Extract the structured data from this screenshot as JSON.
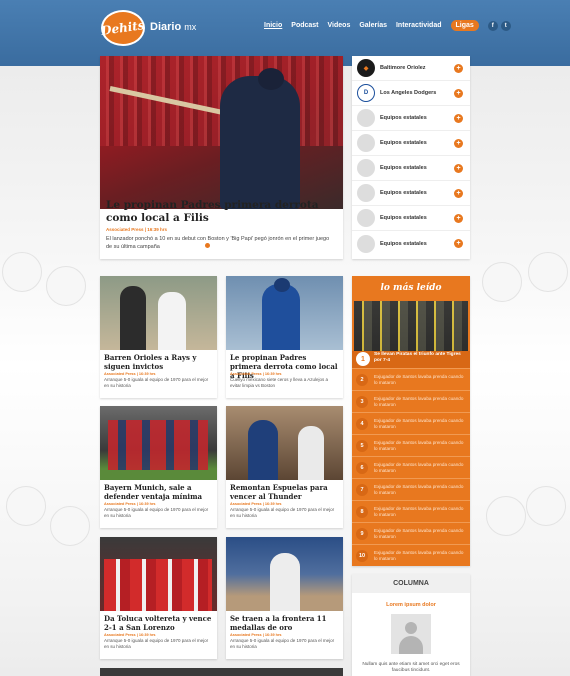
{
  "header": {
    "logo_text": "Dehits",
    "partner_name": "Diario",
    "partner_suffix": "mx",
    "nav": [
      {
        "label": "Inicio",
        "active": true
      },
      {
        "label": "Podcast"
      },
      {
        "label": "Videos"
      },
      {
        "label": "Galerías"
      },
      {
        "label": "Interactividad"
      },
      {
        "label": "Ligas",
        "pill": true
      }
    ],
    "social": [
      {
        "icon": "facebook-icon",
        "glyph": "f"
      },
      {
        "icon": "twitter-icon",
        "glyph": "t"
      }
    ],
    "colors": {
      "header_blue": "#3f74a8",
      "accent_orange": "#e8781f"
    }
  },
  "featured": {
    "title": "Le propinan Padres primera derrota como local a Filis",
    "byline_author": "Associated Press",
    "byline_time": "16:39 hrs",
    "summary": "El lanzador ponchó a 10 en su debut con Boston y 'Big Papi' pegó jonrón en el primer juego de su última campaña",
    "slides": 4,
    "active_slide": 1
  },
  "teams": [
    {
      "name": "Baltimore Oriolez",
      "logo": "orioles-logo"
    },
    {
      "name": "Los Angeles Dodgers",
      "logo": "dodgers-logo"
    },
    {
      "name": "Equipos estatales"
    },
    {
      "name": "Equipos estatales"
    },
    {
      "name": "Equipos estatales"
    },
    {
      "name": "Equipos estatales"
    },
    {
      "name": "Equipos estatales"
    },
    {
      "name": "Equipos estatales"
    }
  ],
  "cards": [
    {
      "title": "Barren Orioles a Rays y siguen invictos",
      "author": "Associated Press",
      "time": "16:39 hrs",
      "text": "Arranque 5-0 iguala al equipo de 1970 para el mejor en su historia"
    },
    {
      "title": "Le propinan Padres primera derrota como local a Filis",
      "author": "Associated Press",
      "time": "16:39 hrs",
      "text": "Cuellyo mexicano siete ceros y lleva a Azulejos a evitar limpia vs Boston"
    },
    {
      "title": "Bayern Munich, sale a defender ventaja mínima",
      "author": "Associated Press",
      "time": "16:39 hrs",
      "text": "Arranque 5-0 iguala al equipo de 1970 para el mejor en su historia"
    },
    {
      "title": "Remontan Espuelas para vencer al Thunder",
      "author": "Associated Press",
      "time": "16:39 hrs",
      "text": "Arranque 5-0 iguala al equipo de 1970 para el mejor en su historia"
    },
    {
      "title": "Da Toluca voltereta y vence 2-1 a San Lorenzo",
      "author": "Associated Press",
      "time": "16:39 hrs",
      "text": "Arranque 5-0 iguala al equipo de 1970 para el mejor en su historia"
    },
    {
      "title": "Se traen a la frontera 11 medallas de oro",
      "author": "Associated Press",
      "time": "16:39 hrs",
      "text": "Arranque 5-0 iguala al equipo de 1970 para el mejor en su historia"
    }
  ],
  "mostread": {
    "title": "lo más leído",
    "first": {
      "rank": "1",
      "text": "Se llevan Piratas el triunfo ante Tigres por 7-4"
    },
    "items": [
      {
        "rank": "2",
        "text": "Exjugador de Santos lavaba prenda cuando lo mataron"
      },
      {
        "rank": "3",
        "text": "Exjugador de Santos lavaba prenda cuando lo mataron"
      },
      {
        "rank": "4",
        "text": "Exjugador de Santos lavaba prenda cuando lo mataron"
      },
      {
        "rank": "5",
        "text": "Exjugador de Santos lavaba prenda cuando lo mataron"
      },
      {
        "rank": "6",
        "text": "Exjugador de Santos lavaba prenda cuando lo mataron"
      },
      {
        "rank": "7",
        "text": "Exjugador de Santos lavaba prenda cuando lo mataron"
      },
      {
        "rank": "8",
        "text": "Exjugador de Santos lavaba prenda cuando lo mataron"
      },
      {
        "rank": "9",
        "text": "Exjugador de Santos lavaba prenda cuando lo mataron"
      },
      {
        "rank": "10",
        "text": "Exjugador de Santos lavaba prenda cuando lo mataron"
      }
    ]
  },
  "columna": {
    "heading": "COLUMNA",
    "subtitle": "Lorem ipsum dolor",
    "text": "Nullam quis ante etiam sit amet orci eget eros faucibus tincidunt."
  }
}
